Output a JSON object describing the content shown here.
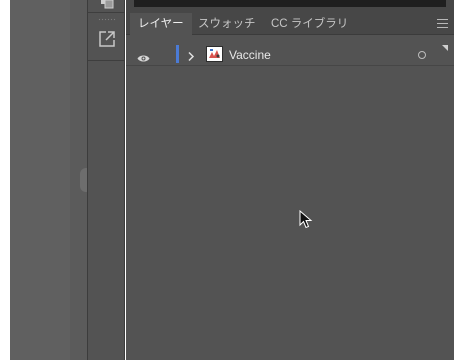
{
  "tabs": [
    {
      "label": "レイヤー",
      "active": true
    },
    {
      "label": "スウォッチ",
      "active": false
    },
    {
      "label": "CC ライブラリ",
      "active": false
    }
  ],
  "layers": [
    {
      "name": "Vaccine",
      "visible": true,
      "expanded": false,
      "color": "#4b7bd6"
    }
  ],
  "icons": {
    "tool_top": "arrange-icon",
    "tool_export": "export-icon",
    "panel_menu": "hamburger-menu-icon",
    "eye": "eye-icon",
    "chevron": "chevron-right-icon",
    "target": "target-circle-icon",
    "cursor": "mouse-pointer-icon"
  },
  "colors": {
    "panel_bg": "#535353",
    "tabbar_bg": "#474747",
    "layer_color": "#4b7bd6"
  }
}
